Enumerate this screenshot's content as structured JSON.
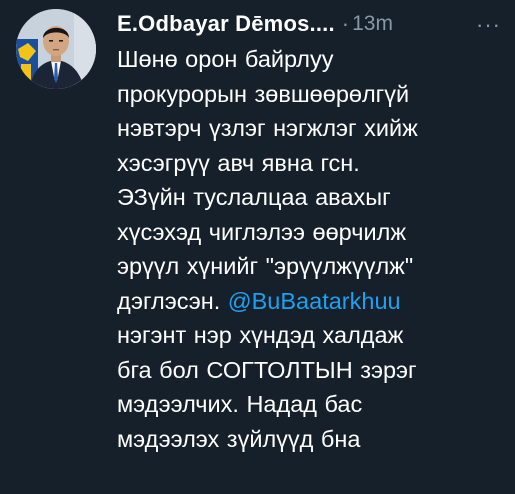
{
  "tweet": {
    "author_name": "E.Odbayar Dēmos....",
    "separator": "·",
    "timestamp": "13m",
    "more_label": "···",
    "avatar_icon": "user-avatar-photo",
    "mention_color": "#1da1f2",
    "lines": [
      "Шөнө орон байрлуу",
      "прокурорын зөвшөөрөлгүй",
      "нэвтэрч үзлэг нэгжлэг хийж",
      "хэсэгрүү авч явна гсн.",
      "ЭЗүйн туслалцаа авахыг",
      "хүсэхэд чиглэлээ өөрчилж",
      "эрүүл хүнийг \"эрүүлжүүлж\"",
      "дэглэсэн.",
      "нэгэнт нэр хүндэд халдаж",
      "бга бол СОГТОЛТЫН зэрэг",
      "мэдээлчих. Надад бас",
      "мэдээлэх зүйлүүд бна"
    ],
    "mention": "@BuBaatarkhuu"
  }
}
